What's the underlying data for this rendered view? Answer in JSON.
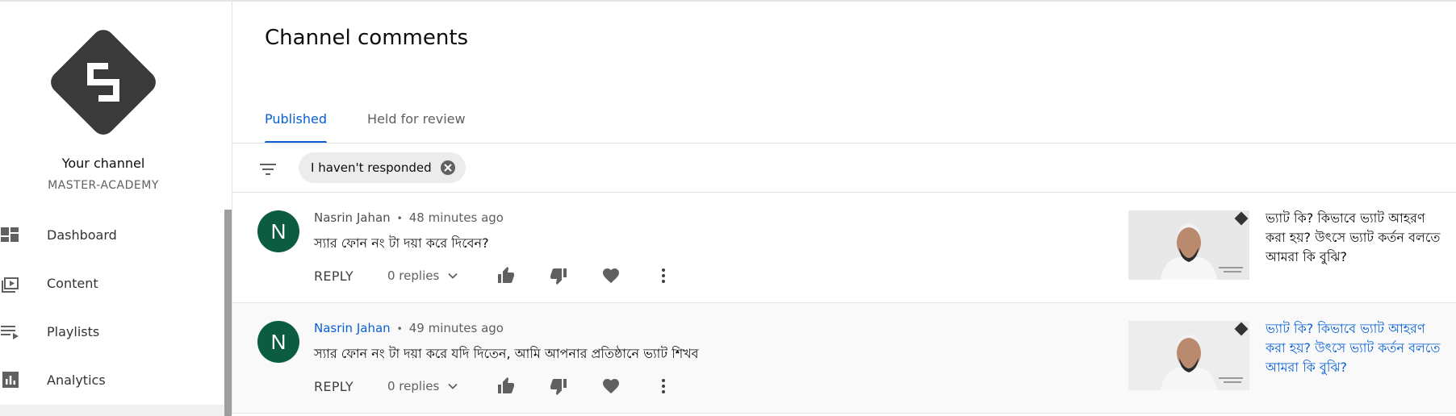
{
  "sidebar": {
    "channel_title": "Your channel",
    "channel_handle": "MASTER-ACADEMY",
    "items": [
      {
        "label": "Dashboard",
        "icon": "dashboard-icon"
      },
      {
        "label": "Content",
        "icon": "content-icon"
      },
      {
        "label": "Playlists",
        "icon": "playlists-icon"
      },
      {
        "label": "Analytics",
        "icon": "analytics-icon"
      }
    ]
  },
  "main": {
    "title": "Channel comments",
    "tabs": [
      {
        "label": "Published",
        "active": true
      },
      {
        "label": "Held for review",
        "active": false
      }
    ],
    "filter": {
      "icon": "filter-icon",
      "chip_label": "I haven't responded"
    },
    "comments": [
      {
        "avatar_letter": "N",
        "author": "Nasrin Jahan",
        "time": "48 minutes ago",
        "text": "স্যার ফোন নং টা দয়া করে দিবেন?",
        "reply_label": "REPLY",
        "replies_label": "0 replies",
        "video_title": "ভ্যাট কি? কিভাবে ভ্যাট আহরণ করা হয়? উৎসে ভ্যাট কর্তন বলতে আমরা কি বুঝি?"
      },
      {
        "avatar_letter": "N",
        "author": "Nasrin Jahan",
        "time": "49 minutes ago",
        "text": "স্যার ফোন নং টা দয়া করে যদি দিতেন, আমি আপনার প্রতিষ্ঠানে ভ্যাট শিখব",
        "reply_label": "REPLY",
        "replies_label": "0 replies",
        "video_title": "ভ্যাট কি? কিভাবে ভ্যাট আহরণ করা হয়? উৎসে ভ্যাট কর্তন বলতে আমরা কি বুঝি?"
      }
    ]
  },
  "colors": {
    "accent": "#065fd4",
    "avatar_bg": "#0b5c41",
    "logo": "#3a3a3a"
  }
}
